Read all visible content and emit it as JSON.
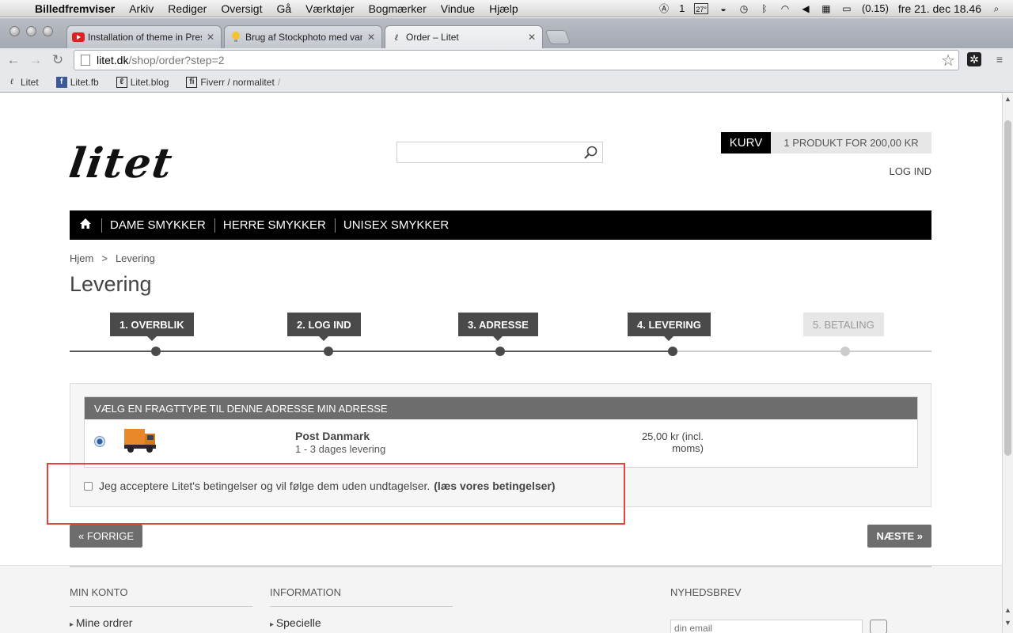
{
  "menubar": {
    "app": "Billedfremviser",
    "items": [
      "Arkiv",
      "Rediger",
      "Oversigt",
      "Gå",
      "Værktøjer",
      "Bogmærker",
      "Vindue",
      "Hjælp"
    ],
    "tray_adobe_count": "1",
    "tray_temp": "27°",
    "battery_text": "(0.15)",
    "clock": "fre 21. dec 18.46"
  },
  "browser": {
    "tabs": [
      {
        "title": "Installation of theme in Presta",
        "icon": "youtube-icon"
      },
      {
        "title": "Brug af Stockphoto med vandm",
        "icon": "bulb-icon"
      },
      {
        "title": "Order – Litet",
        "icon": "litet-icon"
      }
    ],
    "url_host": "litet.dk",
    "url_path": "/shop/order?step=2",
    "bookmarks": [
      {
        "label": "Litet",
        "icon": "litet-icon"
      },
      {
        "label": "Litet.fb",
        "icon": "facebook-icon"
      },
      {
        "label": "Litet.blog",
        "icon": "blog-icon"
      },
      {
        "label": "Fiverr / normalitet",
        "icon": "fiverr-icon"
      }
    ],
    "bookmark_overflow": "/"
  },
  "site": {
    "logo": "litet",
    "search_placeholder": "",
    "cart_label": "KURV",
    "cart_summary": "1 PRODUKT FOR 200,00 KR",
    "login": "LOG IND",
    "nav": [
      "DAME SMYKKER",
      "HERRE SMYKKER",
      "UNISEX SMYKKER"
    ]
  },
  "breadcrumb": {
    "home": "Hjem",
    "separator": ">",
    "current": "Levering"
  },
  "page_title": "Levering",
  "steps": [
    {
      "label": "1. OVERBLIK",
      "state": "done"
    },
    {
      "label": "2. LOG IND",
      "state": "done"
    },
    {
      "label": "3. ADRESSE",
      "state": "done"
    },
    {
      "label": "4. LEVERING",
      "state": "current"
    },
    {
      "label": "5. BETALING",
      "state": "pending"
    }
  ],
  "shipping": {
    "header": "VÆLG EN FRAGTTYPE TIL DENNE ADRESSE MIN ADRESSE",
    "carrier_name": "Post Danmark",
    "carrier_delay": "1 - 3 dages levering",
    "price_line1": "25,00 kr (incl.",
    "price_line2": "moms)",
    "selected": true
  },
  "terms": {
    "text": "Jeg acceptere Litet's betingelser og vil følge dem uden undtagelser.",
    "link": "(læs vores betingelser)",
    "checked": false
  },
  "buttons": {
    "prev": "« FORRIGE",
    "next": "NÆSTE »"
  },
  "footer": {
    "col1_title": "MIN KONTO",
    "col1_link": "Mine ordrer",
    "col2_title": "INFORMATION",
    "col2_link": "Specielle",
    "newsletter_title": "NYHEDSBREV",
    "email_placeholder": "din email"
  },
  "colors": {
    "highlight": "#e0443a",
    "step_done": "#4a4a4a",
    "step_pending": "#e6e6e6"
  }
}
